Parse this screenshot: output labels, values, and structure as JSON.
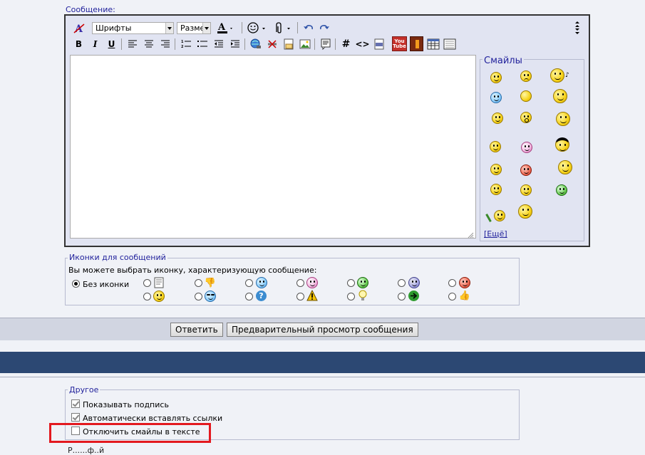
{
  "editor": {
    "message_label": "Сообщение:",
    "font_combo": "Шрифты",
    "size_combo": "Разме",
    "smilies_title": "Смайлы",
    "more_link": "[Ещё]",
    "youtube_icon_text": "You Tube"
  },
  "icons_section": {
    "legend": "Иконки для сообщений",
    "description": "Вы можете выбрать иконку, характеризующую сообщение:",
    "no_icon_label": "Без иконки",
    "selected": "Без иконки"
  },
  "buttons": {
    "reply": "Ответить",
    "preview": "Предварительный просмотр сообщения"
  },
  "other_section": {
    "legend": "Другое",
    "options": [
      {
        "label": "Показывать подпись",
        "checked": true
      },
      {
        "label": "Автоматически вставлять ссылки",
        "checked": true
      },
      {
        "label": "Отключить смайлы в тексте",
        "checked": false
      }
    ],
    "cut_text": "Р......ф..й"
  },
  "colors": {
    "header_bar": "#2c4873",
    "highlight": "#e3191f",
    "legend_text": "#22229c"
  }
}
